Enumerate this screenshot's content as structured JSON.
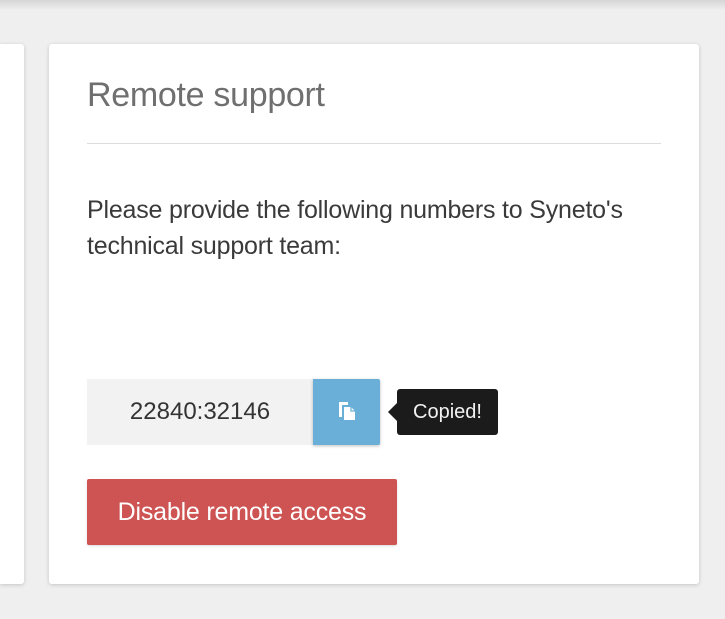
{
  "card": {
    "title": "Remote support",
    "instructions": "Please provide the following numbers to Syneto's technical support team:",
    "support_code": "22840:32146",
    "copy_button_icon": "clipboard-icon",
    "tooltip": "Copied!",
    "disable_button_label": "Disable remote access"
  },
  "colors": {
    "copy_button": "#69afd8",
    "disable_button": "#cd5452",
    "tooltip_background": "#1b1b1b",
    "title_text": "#6f6f6f"
  }
}
